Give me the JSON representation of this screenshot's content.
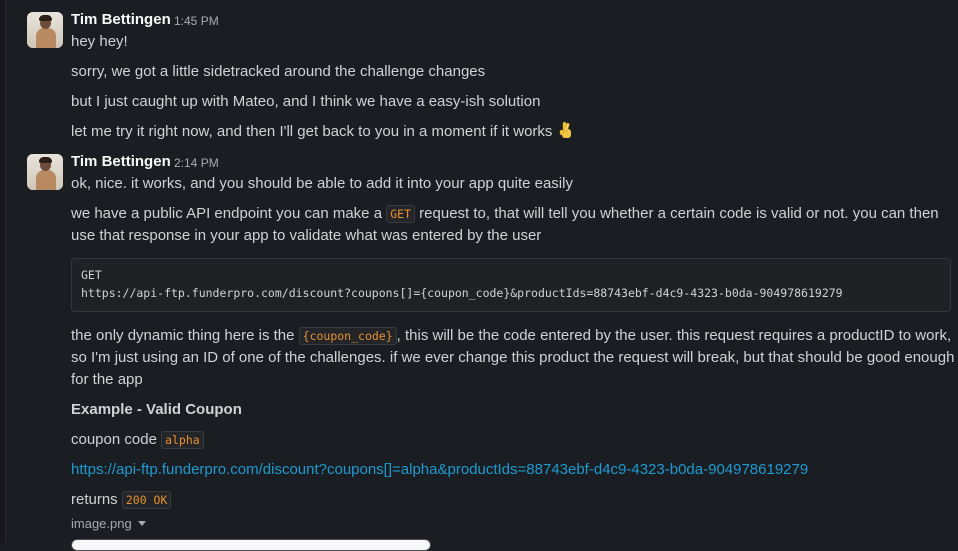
{
  "messages": [
    {
      "author": "Tim Bettingen",
      "time": "1:45 PM",
      "lines": [
        "hey hey!",
        "sorry, we got a little sidetracked around the challenge changes",
        "but I just caught up with Mateo, and I think we have a easy-ish solution",
        "let me try it right now, and then I'll get back to you in a moment if it works"
      ],
      "emoji": "crossed-fingers"
    },
    {
      "author": "Tim Bettingen",
      "time": "2:14 PM",
      "line1": "ok, nice. it works, and you should be able to add it into your app quite easily",
      "line2_a": "we have a public API endpoint you can make a ",
      "line2_code": "GET",
      "line2_b": " request to, that will tell you whether a certain code is valid or not. you can then",
      "line2_c": "use that response in your app to validate what was entered by the user",
      "code_block": {
        "line1": "GET",
        "line2": "https://api-ftp.funderpro.com/discount?coupons[]={coupon_code}&productIds=88743ebf-d4c9-4323-b0da-904978619279"
      },
      "p3_a": "the only dynamic thing here is the ",
      "p3_code": "{coupon_code}",
      "p3_b": ", this will be the code entered by the user. this request requires a productID to work,",
      "p3_c": "so I'm just using an ID of one of the challenges. if we ever change this product the request will break, but that should be good enough",
      "p3_d": "for the app",
      "example_title": "Example - Valid Coupon",
      "coupon_label": "coupon code ",
      "coupon_code": "alpha",
      "example_link": "https://api-ftp.funderpro.com/discount?coupons[]=alpha&productIds=88743ebf-d4c9-4323-b0da-904978619279",
      "returns_label": "returns ",
      "returns_code": "200 OK",
      "attachment": "image.png"
    }
  ],
  "colors": {
    "background": "#1a1d21",
    "link": "#1d9bd1",
    "code": "#e8912d"
  }
}
